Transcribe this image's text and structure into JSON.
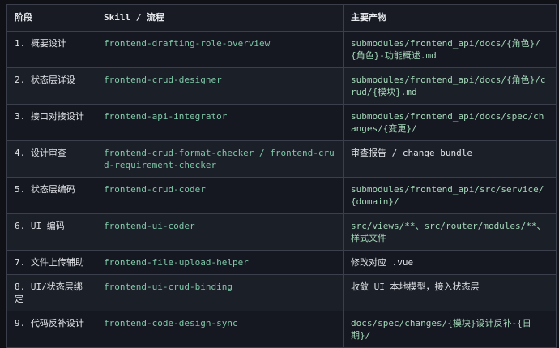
{
  "table": {
    "headers": [
      "阶段",
      "Skill / 流程",
      "主要产物"
    ],
    "rows": [
      {
        "stage": "1. 概要设计",
        "skill": "frontend-drafting-role-overview",
        "output": "submodules/frontend_api/docs/{角色}/{角色}-功能概述.md",
        "output_style": "code"
      },
      {
        "stage": "2. 状态层详设",
        "skill": "frontend-crud-designer",
        "output": "submodules/frontend_api/docs/{角色}/crud/{模块}.md",
        "output_style": "code"
      },
      {
        "stage": "3. 接口对接设计",
        "skill": "frontend-api-integrator",
        "output": "submodules/frontend_api/docs/spec/changes/{变更}/",
        "output_style": "code"
      },
      {
        "stage": "4. 设计审查",
        "skill": "frontend-crud-format-checker / frontend-crud-requirement-checker",
        "output": "审查报告 / change bundle",
        "output_style": "plain"
      },
      {
        "stage": "5. 状态层编码",
        "skill": "frontend-crud-coder",
        "output": "submodules/frontend_api/src/service/{domain}/",
        "output_style": "code"
      },
      {
        "stage": "6. UI 编码",
        "skill": "frontend-ui-coder",
        "output": "src/views/**、src/router/modules/**、样式文件",
        "output_style": "code"
      },
      {
        "stage": "7. 文件上传辅助",
        "skill": "frontend-file-upload-helper",
        "output": "修改对应 .vue",
        "output_style": "plain"
      },
      {
        "stage": "8. UI/状态层绑定",
        "skill": "frontend-ui-crud-binding",
        "output": "收敛 UI 本地模型，接入状态层",
        "output_style": "plain"
      },
      {
        "stage": "9. 代码反补设计",
        "skill": "frontend-code-design-sync",
        "output": "docs/spec/changes/{模块}设计反补-{日期}/",
        "output_style": "code"
      }
    ]
  },
  "colors": {
    "background": "#0f1117",
    "border": "#3a3f4b",
    "skill_text": "#7fc7a8",
    "output_code_text": "#a4d7b9"
  }
}
